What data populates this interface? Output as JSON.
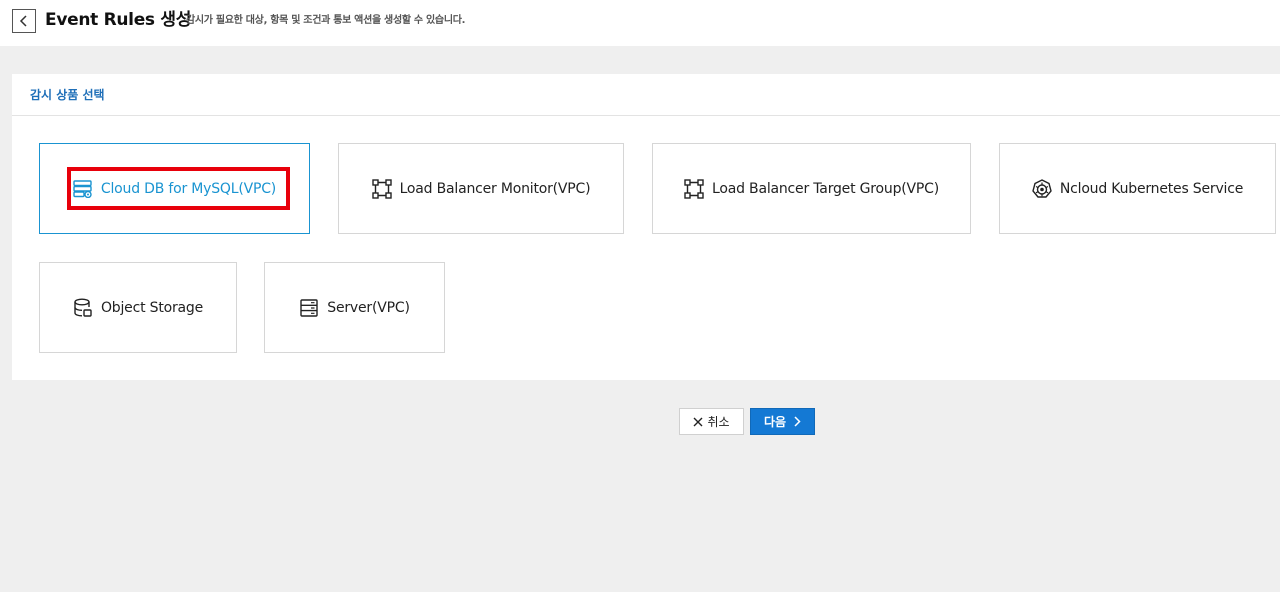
{
  "header": {
    "title": "Event Rules 생성",
    "description": "감시가 필요한 대상, 항목 및 조건과 통보 액션을 생성할 수 있습니다."
  },
  "panel": {
    "title": "감시 상품 선택",
    "products": [
      {
        "label": "Cloud DB for MySQL(VPC)",
        "icon": "database-server-icon",
        "selected": true
      },
      {
        "label": "Load Balancer Monitor(VPC)",
        "icon": "load-balancer-icon",
        "selected": false
      },
      {
        "label": "Load Balancer Target Group(VPC)",
        "icon": "load-balancer-icon",
        "selected": false
      },
      {
        "label": "Ncloud Kubernetes Service",
        "icon": "kubernetes-icon",
        "selected": false
      },
      {
        "label": "Object Storage",
        "icon": "object-storage-icon",
        "selected": false
      },
      {
        "label": "Server(VPC)",
        "icon": "server-icon",
        "selected": false
      }
    ]
  },
  "actions": {
    "cancel_label": "취소",
    "next_label": "다음"
  },
  "colors": {
    "accent": "#1a94d1",
    "primary_button": "#1479d4",
    "highlight": "#e8000b"
  }
}
